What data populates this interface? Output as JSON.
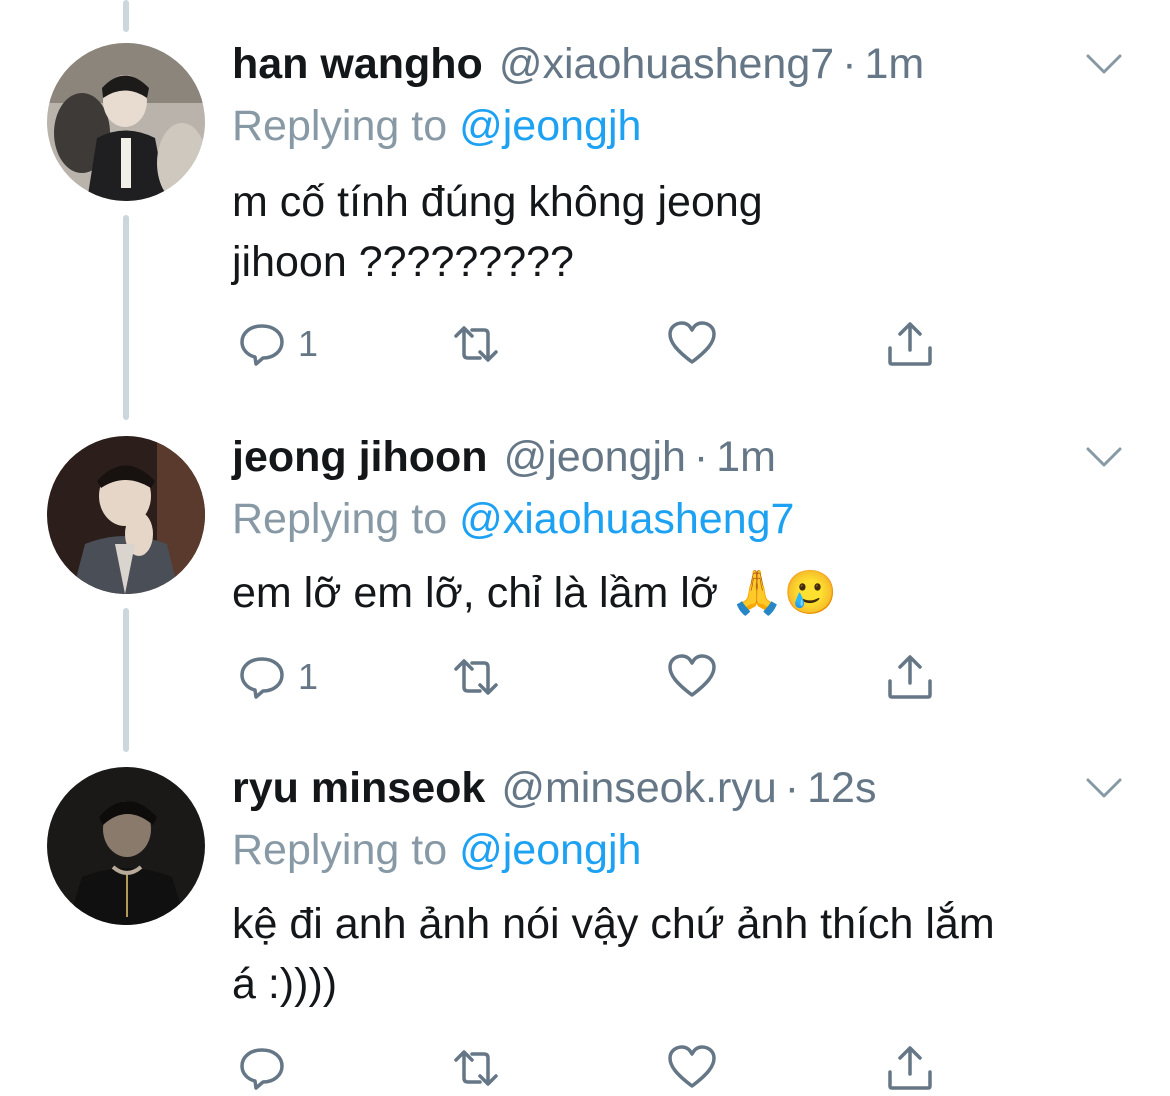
{
  "tweets": [
    {
      "name": "han wangho",
      "handle": "@xiaohuasheng7",
      "separator": "·",
      "time": "1m",
      "replying_prefix": "Replying to",
      "replying_to": "@jeongjh",
      "text_lines": [
        "m cố tính đúng không jeong",
        "jihoon ?????????"
      ],
      "reply_count": "1",
      "avatar_desc": "avatar"
    },
    {
      "name": "jeong jihoon",
      "handle": "@jeongjh",
      "separator": "·",
      "time": "1m",
      "replying_prefix": "Replying to",
      "replying_to": "@xiaohuasheng7",
      "text_lines": [
        "em lỡ em lỡ, chỉ là lầm lỡ 🙏🥲"
      ],
      "reply_count": "1",
      "avatar_desc": "avatar"
    },
    {
      "name": "ryu minseok",
      "handle": "@minseok.ryu",
      "separator": "·",
      "time": "12s",
      "replying_prefix": "Replying to",
      "replying_to": "@jeongjh",
      "text_lines": [
        "kệ đi anh ảnh nói vậy chứ ảnh thích lắm",
        "á :))))"
      ],
      "reply_count": "",
      "avatar_desc": "avatar"
    }
  ],
  "colors": {
    "text": "#14171a",
    "secondary": "#657786",
    "mention": "#1da1f2",
    "thread_line": "#ccd6dd",
    "icon": "#657786"
  },
  "icons": [
    "reply-icon",
    "retweet-icon",
    "like-icon",
    "share-icon",
    "chevron-down-icon"
  ]
}
